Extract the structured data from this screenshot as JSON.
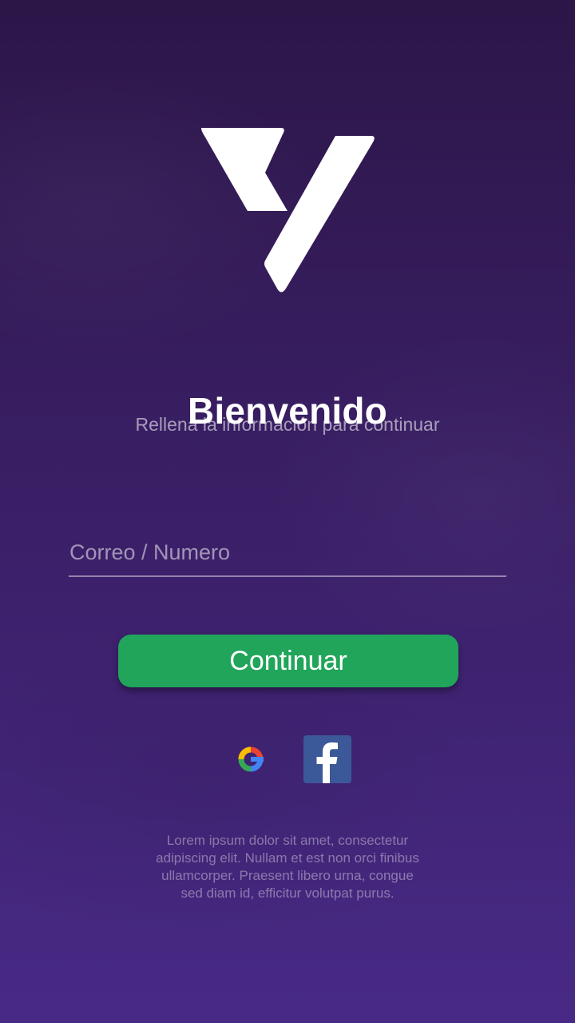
{
  "brand": {
    "logo": "white-v-brand-logo",
    "logo_color": "#ffffff"
  },
  "welcome": {
    "title": "Bienvenido",
    "subtitle": "Rellena la información para continuar"
  },
  "login_form": {
    "identifier_placeholder": "Correo / Numero",
    "identifier_value": "",
    "continue_label": "Continuar"
  },
  "social_login": [
    {
      "name": "Google",
      "icon": "google-icon"
    },
    {
      "name": "Facebook",
      "icon": "facebook-icon"
    }
  ],
  "legal_text": "Lorem ipsum dolor sit amet, consectetur adipiscing elit. Nullam et est non orci finibus ullamcorper. Praesent libero urna, congue sed diam id, efficitur volutpat purus.",
  "colors": {
    "background_top": "#2c1648",
    "background_bottom": "#482a86",
    "button_green": "#21a55a",
    "facebook_blue": "#3b5998",
    "text_white": "#ffffff"
  }
}
